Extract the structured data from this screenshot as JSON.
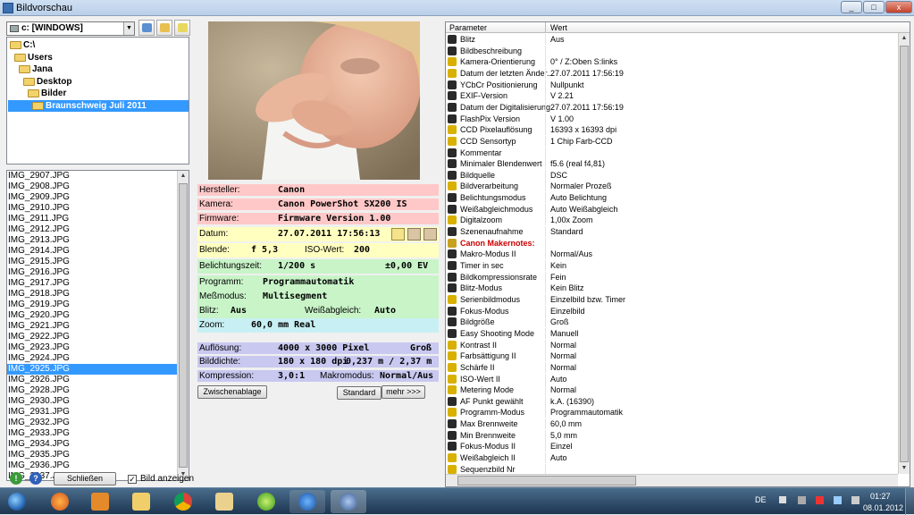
{
  "window": {
    "title": "Bildvorschau",
    "controls": [
      "_",
      "□",
      "x"
    ]
  },
  "drive": {
    "selected": "c: [WINDOWS]"
  },
  "tree": [
    {
      "label": "C:\\",
      "level": 0
    },
    {
      "label": "Users",
      "level": 1
    },
    {
      "label": "Jana",
      "level": 2
    },
    {
      "label": "Desktop",
      "level": 3
    },
    {
      "label": "Bilder",
      "level": 4
    },
    {
      "label": "Braunschweig Juli 2011",
      "level": 5,
      "selected": true
    }
  ],
  "files": [
    "IMG_2907.JPG",
    "IMG_2908.JPG",
    "IMG_2909.JPG",
    "IMG_2910.JPG",
    "IMG_2911.JPG",
    "IMG_2912.JPG",
    "IMG_2913.JPG",
    "IMG_2914.JPG",
    "IMG_2915.JPG",
    "IMG_2916.JPG",
    "IMG_2917.JPG",
    "IMG_2918.JPG",
    "IMG_2919.JPG",
    "IMG_2920.JPG",
    "IMG_2921.JPG",
    "IMG_2922.JPG",
    "IMG_2923.JPG",
    "IMG_2924.JPG",
    "IMG_2925.JPG",
    "IMG_2926.JPG",
    "IMG_2928.JPG",
    "IMG_2930.JPG",
    "IMG_2931.JPG",
    "IMG_2932.JPG",
    "IMG_2933.JPG",
    "IMG_2934.JPG",
    "IMG_2935.JPG",
    "IMG_2936.JPG",
    "IMG_2937.JPG"
  ],
  "selected_file": "IMG_2925.JPG",
  "info": {
    "hersteller": {
      "label": "Hersteller:",
      "value": "Canon"
    },
    "kamera": {
      "label": "Kamera:",
      "value": "Canon PowerShot SX200 IS"
    },
    "firmware": {
      "label": "Firmware:",
      "value": "Firmware Version 1.00"
    },
    "datum": {
      "label": "Datum:",
      "value": "27.07.2011 17:56:13"
    },
    "blende": {
      "label": "Blende:",
      "value": "f 5,3"
    },
    "iso": {
      "label": "ISO-Wert:",
      "value": "200"
    },
    "belichtungszeit": {
      "label": "Belichtungszeit:",
      "value": "1/200 s"
    },
    "ev": {
      "value": "±0,00 EV"
    },
    "programm": {
      "label": "Programm:",
      "value": "Programmautomatik"
    },
    "messmodus": {
      "label": "Meßmodus:",
      "value": "Multisegment"
    },
    "blitz": {
      "label": "Blitz:",
      "value": "Aus"
    },
    "weissabgleich": {
      "label": "Weißabgleich:",
      "value": "Auto"
    },
    "zoom": {
      "label": "Zoom:",
      "value": "60,0 mm Real"
    },
    "aufloesung": {
      "label": "Auflösung:",
      "value": "4000 x 3000 Pixel",
      "size": "Groß"
    },
    "bilddichte": {
      "label": "Bilddichte:",
      "value": "180 x 180 dpi",
      "dim": "0,237 m / 2,37 m"
    },
    "kompression": {
      "label": "Kompression:",
      "value": "3,0:1"
    },
    "makromodus": {
      "label": "Makromodus:",
      "value": "Normal/Aus"
    }
  },
  "buttons": {
    "clipboard": "Zwischenablage",
    "standard": "Standard",
    "mehr": "mehr >>>",
    "close": "Schließen",
    "show_image": "Bild anzeigen"
  },
  "grid": {
    "headers": [
      "Parameter",
      "Wert"
    ],
    "rows": [
      [
        "Blitz",
        "Aus"
      ],
      [
        "Bildbeschreibung",
        ""
      ],
      [
        "Kamera-Orientierung",
        "0° / Z:Oben S:links"
      ],
      [
        "Datum der letzten Änder...",
        "27.07.2011 17:56:19"
      ],
      [
        "YCbCr Positionierung",
        "Nullpunkt"
      ],
      [
        "EXIF-Version",
        "V 2.21"
      ],
      [
        "Datum der Digitalisierung",
        "27.07.2011 17:56:19"
      ],
      [
        "FlashPix Version",
        "V 1.00"
      ],
      [
        "CCD Pixelauflösung",
        "16393 x 16393 dpi"
      ],
      [
        "CCD Sensortyp",
        "1 Chip Farb-CCD"
      ],
      [
        "Kommentar",
        ""
      ],
      [
        "Minimaler Blendenwert",
        "f5.6 (real f4,81)"
      ],
      [
        "Bildquelle",
        "DSC"
      ],
      [
        "Bildverarbeitung",
        "Normaler Prozeß"
      ],
      [
        "Belichtungsmodus",
        "Auto Belichtung"
      ],
      [
        "Weißabgleichmodus",
        "Auto Weißabgleich"
      ],
      [
        "Digitalzoom",
        "1,00x Zoom"
      ],
      [
        "Szenenaufnahme",
        "Standard"
      ],
      [
        "Canon Makernotes:",
        ""
      ],
      [
        "Makro-Modus II",
        "Normal/Aus"
      ],
      [
        "Timer in sec",
        "Kein"
      ],
      [
        "Bildkompressionsrate",
        "Fein"
      ],
      [
        "Blitz-Modus",
        "Kein Blitz"
      ],
      [
        "Serienbildmodus",
        "Einzelbild bzw. Timer"
      ],
      [
        "Fokus-Modus",
        "Einzelbild"
      ],
      [
        "Bildgröße",
        "Groß"
      ],
      [
        "Easy Shooting Mode",
        "Manuell"
      ],
      [
        "Kontrast II",
        "Normal"
      ],
      [
        "Farbsättigung II",
        "Normal"
      ],
      [
        "Schärfe II",
        "Normal"
      ],
      [
        "ISO-Wert II",
        "Auto"
      ],
      [
        "Metering Mode",
        "Normal"
      ],
      [
        "AF Punkt gewählt",
        "k.A. (16390)"
      ],
      [
        "Programm-Modus",
        "Programmautomatik"
      ],
      [
        "Max Brennweite",
        "60,0 mm"
      ],
      [
        "Min Brennweite",
        "5,0 mm"
      ],
      [
        "Fokus-Modus II",
        "Einzel"
      ],
      [
        "Weißabgleich II",
        "Auto"
      ],
      [
        "Sequenzbild Nr",
        ""
      ]
    ]
  },
  "taskbar": {
    "language": "DE",
    "time": "01:27",
    "date": "08.01.2012"
  },
  "colors": {
    "pink": "#ffc8c8",
    "yellow": "#ffffc0",
    "green": "#c8f4c8",
    "cyan": "#c8f0f4",
    "lavender": "#c8c8f0",
    "selection": "#3399ff",
    "makernotes": "#cc0000"
  }
}
